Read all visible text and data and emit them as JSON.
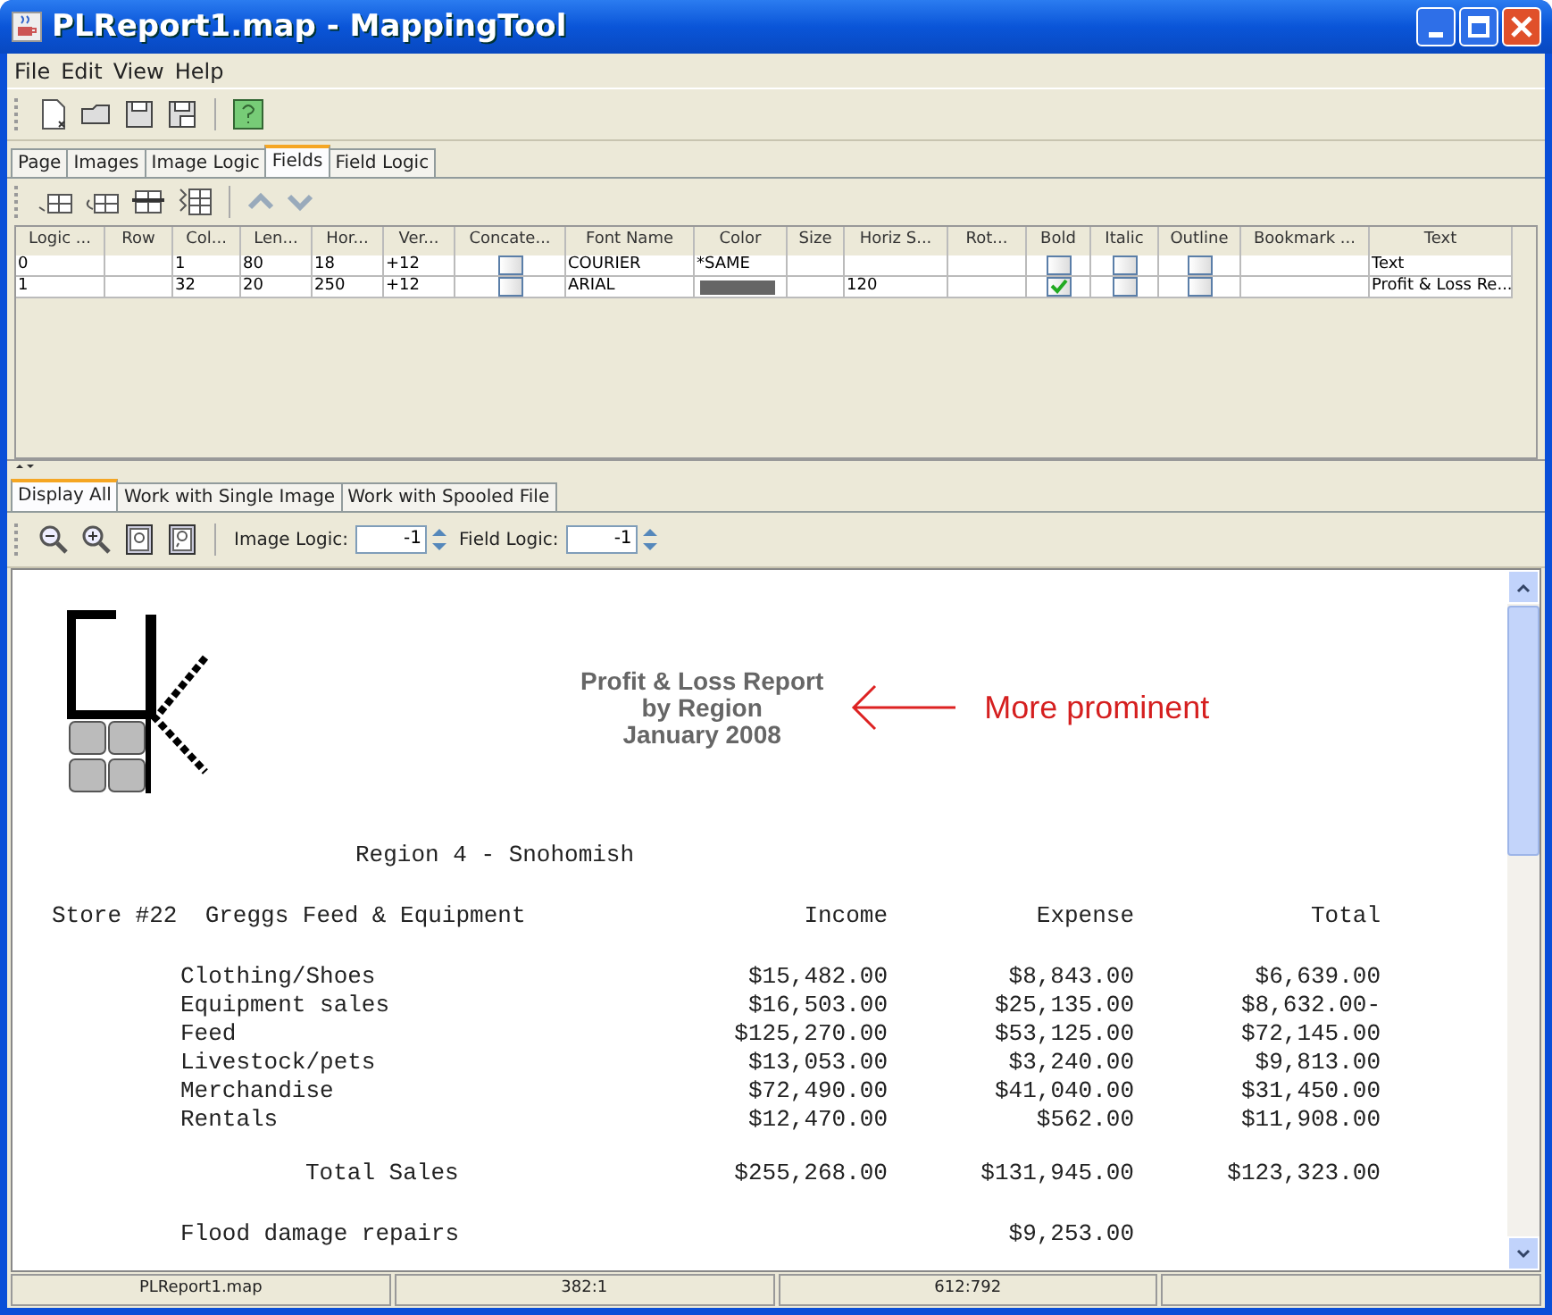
{
  "window": {
    "title": "PLReport1.map - MappingTool"
  },
  "menu": [
    "File",
    "Edit",
    "View",
    "Help"
  ],
  "top_tabs": [
    {
      "label": "Page",
      "selected": false
    },
    {
      "label": "Images",
      "selected": false
    },
    {
      "label": "Image Logic",
      "selected": false
    },
    {
      "label": "Fields",
      "selected": true
    },
    {
      "label": "Field Logic",
      "selected": false
    }
  ],
  "fields_table": {
    "columns": [
      "Logic ...",
      "Row",
      "Col...",
      "Len...",
      "Hor...",
      "Ver...",
      "Concate...",
      "Font Name",
      "Color",
      "Size",
      "Horiz S...",
      "Rot...",
      "Bold",
      "Italic",
      "Outline",
      "Bookmark ...",
      "Text"
    ],
    "rows": [
      [
        "0",
        null,
        "1",
        "80",
        "18",
        "+12",
        {
          "checked": false
        },
        "COURIER",
        "*SAME",
        null,
        null,
        null,
        {
          "checked": false
        },
        {
          "checked": false
        },
        {
          "checked": false
        },
        null,
        "Text"
      ],
      [
        "1",
        null,
        "32",
        "20",
        "250",
        "+12",
        {
          "checked": false
        },
        "ARIAL",
        {
          "color": "#666666"
        },
        null,
        "120",
        null,
        {
          "checked": true
        },
        {
          "checked": false
        },
        {
          "checked": false
        },
        null,
        "Profit & Loss Re..."
      ]
    ]
  },
  "view_tabs": [
    {
      "label": "Display All",
      "selected": true
    },
    {
      "label": "Work with Single Image",
      "selected": false
    },
    {
      "label": "Work with Spooled File",
      "selected": false
    }
  ],
  "spinners": [
    {
      "label": "Image Logic:",
      "value": "-1"
    },
    {
      "label": "Field Logic:",
      "value": "-1"
    }
  ],
  "report": {
    "title_lines": [
      "Profit & Loss Report",
      "by Region",
      "January 2008"
    ],
    "annotation": "More prominent",
    "region": "Region 4 - Snohomish",
    "store": "Store #22  Greggs Feed & Equipment",
    "columns": [
      "Income",
      "Expense",
      "Total"
    ],
    "lines": [
      [
        "Clothing/Shoes",
        "$15,482.00",
        "$8,843.00",
        "$6,639.00"
      ],
      [
        "Equipment sales",
        "$16,503.00",
        "$25,135.00",
        "$8,632.00-"
      ],
      [
        "Feed",
        "$125,270.00",
        "$53,125.00",
        "$72,145.00"
      ],
      [
        "Livestock/pets",
        "$13,053.00",
        "$3,240.00",
        "$9,813.00"
      ],
      [
        "Merchandise",
        "$72,490.00",
        "$41,040.00",
        "$31,450.00"
      ],
      [
        "Rentals",
        "$12,470.00",
        "$562.00",
        "$11,908.00"
      ]
    ],
    "total": [
      "Total Sales",
      "$255,268.00",
      "$131,945.00",
      "$123,323.00"
    ],
    "expenses": [
      {
        "label": "Flood damage repairs",
        "expense": "$9,253.00"
      }
    ]
  },
  "status_bar": [
    "PLReport1.map",
    "382:1",
    "612:792"
  ]
}
